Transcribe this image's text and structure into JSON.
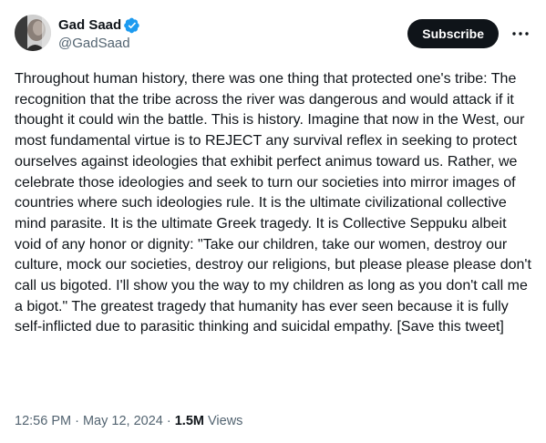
{
  "author": {
    "name": "Gad Saad",
    "handle": "@GadSaad",
    "verified_icon": "verified-badge-icon",
    "avatar_icon": "avatar-photo"
  },
  "actions": {
    "subscribe_label": "Subscribe",
    "more_icon": "more-options-icon"
  },
  "tweet": {
    "text": "Throughout human history, there was one thing that protected one's tribe:  The recognition that the tribe across the river was dangerous and would attack if it thought it could win the battle.  This is history.  Imagine that now in the West, our most fundamental virtue is to REJECT any survival reflex in seeking to protect ourselves against ideologies that exhibit perfect animus toward us.  Rather, we celebrate those ideologies and seek to turn our societies into mirror images of countries where such ideologies rule.  It is the ultimate civilizational collective mind parasite.  It is the ultimate Greek tragedy.  It is Collective Seppuku albeit void of any honor or dignity:  \"Take our children, take our women, destroy our culture, mock our societies, destroy our religions, but please please please don't call us bigoted.  I'll show you the way to my children as long as you don't call me a bigot.\"  The greatest tragedy that humanity has ever seen  because it is fully self-inflicted due to parasitic thinking and suicidal empathy.  [Save this tweet]"
  },
  "meta": {
    "time": "12:56 PM",
    "separator1": " · ",
    "date": "May 12, 2024",
    "separator2": " · ",
    "views_count": "1.5M",
    "views_label": " Views"
  },
  "colors": {
    "text": "#0f1419",
    "secondary": "#536471",
    "verified": "#1d9bf0",
    "subscribe_bg": "#0f1419"
  }
}
